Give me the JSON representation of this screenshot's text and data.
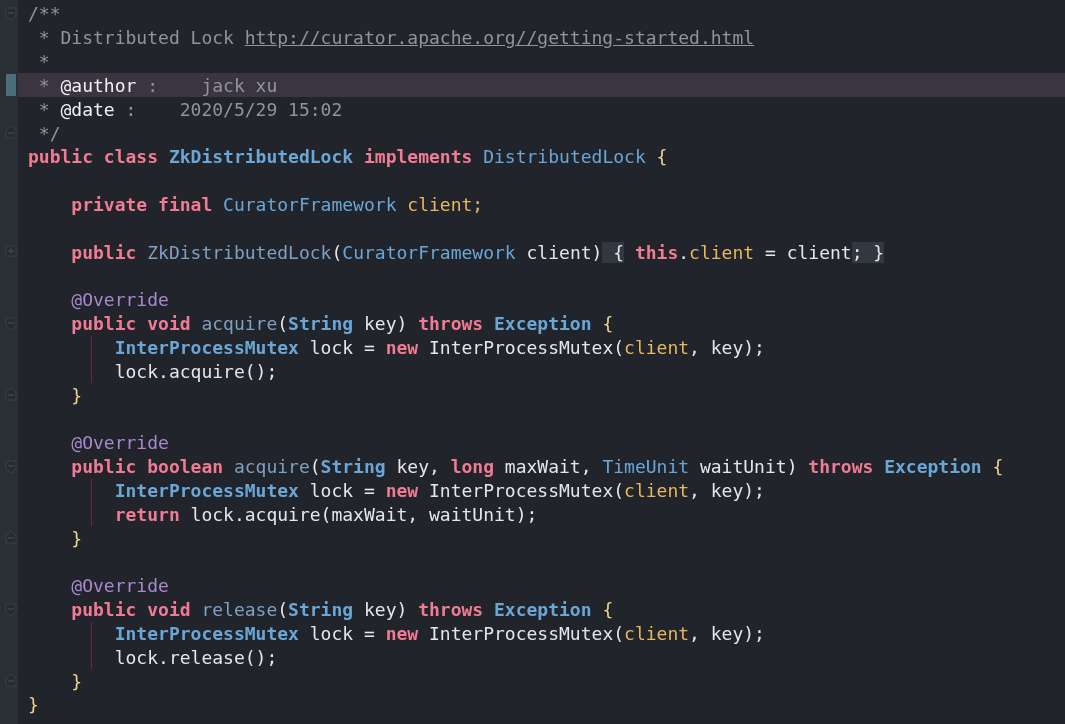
{
  "editor": {
    "blocks": [
      {
        "lines": [
          {
            "fold": {
              "kind": "start"
            },
            "tokens": [
              {
                "kind": "comment",
                "text": "/**"
              }
            ]
          },
          {
            "tokens": [
              {
                "kind": "comment",
                "text": " * Distributed Lock "
              },
              {
                "kind": "link",
                "text": "http://curator.apache.org//getting-started.html"
              }
            ]
          },
          {
            "tokens": [
              {
                "kind": "comment",
                "text": " *"
              }
            ]
          },
          {
            "highlighted": true,
            "tokens": [
              {
                "kind": "comment",
                "text": " * "
              },
              {
                "kind": "tag",
                "text": "@author"
              },
              {
                "kind": "comment",
                "text": " :    jack xu"
              }
            ]
          },
          {
            "tokens": [
              {
                "kind": "comment",
                "text": " * "
              },
              {
                "kind": "tag",
                "text": "@date"
              },
              {
                "kind": "comment",
                "text": " :    2020/5/29 15:02"
              }
            ]
          },
          {
            "fold": {
              "kind": "end"
            },
            "tokens": [
              {
                "kind": "comment",
                "text": " */"
              }
            ]
          },
          {
            "tokens": [
              {
                "kind": "keyword",
                "text": "public class "
              },
              {
                "kind": "type",
                "text": "ZkDistributedLock "
              },
              {
                "kind": "keyword",
                "text": "implements "
              },
              {
                "kind": "typeref",
                "text": "DistributedLock "
              },
              {
                "kind": "brace",
                "text": "{"
              }
            ]
          }
        ]
      },
      {
        "lines": [
          {
            "tokens": [
              {
                "kind": "keyword",
                "text": "    private final "
              },
              {
                "kind": "typeref",
                "text": "CuratorFramework "
              },
              {
                "kind": "field",
                "text": "client;"
              }
            ]
          }
        ]
      },
      {
        "lines": [
          {
            "fold": {
              "kind": "collapsed"
            },
            "tokens": [
              {
                "kind": "keyword",
                "text": "    public "
              },
              {
                "kind": "method",
                "text": "ZkDistributedLock"
              },
              {
                "kind": "plain",
                "text": "("
              },
              {
                "kind": "typeref",
                "text": "CuratorFramework "
              },
              {
                "kind": "plain",
                "text": "client)"
              },
              {
                "kind": "folded",
                "text": " {"
              },
              {
                "kind": "keyword",
                "text": " this"
              },
              {
                "kind": "plain",
                "text": "."
              },
              {
                "kind": "field",
                "text": "client"
              },
              {
                "kind": "plain",
                "text": " = client"
              },
              {
                "kind": "folded",
                "text": "; }"
              }
            ]
          }
        ]
      },
      {
        "lines": [
          {
            "tokens": [
              {
                "kind": "annotation",
                "text": "    @Override"
              }
            ]
          },
          {
            "fold": {
              "kind": "start"
            },
            "tokens": [
              {
                "kind": "keyword",
                "text": "    public void "
              },
              {
                "kind": "method",
                "text": "acquire"
              },
              {
                "kind": "plain",
                "text": "("
              },
              {
                "kind": "type",
                "text": "String "
              },
              {
                "kind": "plain",
                "text": "key) "
              },
              {
                "kind": "keyword",
                "text": "throws "
              },
              {
                "kind": "type",
                "text": "Exception "
              },
              {
                "kind": "brace",
                "text": "{"
              }
            ]
          },
          {
            "guide": true,
            "tokens": [
              {
                "kind": "type",
                "text": "        InterProcessMutex "
              },
              {
                "kind": "plain",
                "text": "lock = "
              },
              {
                "kind": "keyword",
                "text": "new "
              },
              {
                "kind": "plain",
                "text": "InterProcessMutex("
              },
              {
                "kind": "field",
                "text": "client"
              },
              {
                "kind": "plain",
                "text": ", key);"
              }
            ]
          },
          {
            "guide": true,
            "tokens": [
              {
                "kind": "plain",
                "text": "        lock.acquire();"
              }
            ]
          },
          {
            "fold": {
              "kind": "end"
            },
            "tokens": [
              {
                "kind": "brace",
                "text": "    }"
              }
            ]
          }
        ]
      },
      {
        "lines": [
          {
            "tokens": [
              {
                "kind": "annotation",
                "text": "    @Override"
              }
            ]
          },
          {
            "fold": {
              "kind": "start"
            },
            "tokens": [
              {
                "kind": "keyword",
                "text": "    public boolean "
              },
              {
                "kind": "method",
                "text": "acquire"
              },
              {
                "kind": "plain",
                "text": "("
              },
              {
                "kind": "type",
                "text": "String "
              },
              {
                "kind": "plain",
                "text": "key, "
              },
              {
                "kind": "keyword",
                "text": "long "
              },
              {
                "kind": "plain",
                "text": "maxWait, "
              },
              {
                "kind": "typeref",
                "text": "TimeUnit "
              },
              {
                "kind": "plain",
                "text": "waitUnit) "
              },
              {
                "kind": "keyword",
                "text": "throws "
              },
              {
                "kind": "type",
                "text": "Exception "
              },
              {
                "kind": "brace",
                "text": "{"
              }
            ]
          },
          {
            "guide": true,
            "tokens": [
              {
                "kind": "type",
                "text": "        InterProcessMutex "
              },
              {
                "kind": "plain",
                "text": "lock = "
              },
              {
                "kind": "keyword",
                "text": "new "
              },
              {
                "kind": "plain",
                "text": "InterProcessMutex("
              },
              {
                "kind": "field",
                "text": "client"
              },
              {
                "kind": "plain",
                "text": ", key);"
              }
            ]
          },
          {
            "guide": true,
            "tokens": [
              {
                "kind": "keyword",
                "text": "        return "
              },
              {
                "kind": "plain",
                "text": "lock.acquire(maxWait, waitUnit);"
              }
            ]
          },
          {
            "fold": {
              "kind": "end"
            },
            "tokens": [
              {
                "kind": "brace",
                "text": "    }"
              }
            ]
          }
        ]
      },
      {
        "lines": [
          {
            "tokens": [
              {
                "kind": "annotation",
                "text": "    @Override"
              }
            ]
          },
          {
            "fold": {
              "kind": "start"
            },
            "tokens": [
              {
                "kind": "keyword",
                "text": "    public void "
              },
              {
                "kind": "method",
                "text": "release"
              },
              {
                "kind": "plain",
                "text": "("
              },
              {
                "kind": "type",
                "text": "String "
              },
              {
                "kind": "plain",
                "text": "key) "
              },
              {
                "kind": "keyword",
                "text": "throws "
              },
              {
                "kind": "type",
                "text": "Exception "
              },
              {
                "kind": "brace",
                "text": "{"
              }
            ]
          },
          {
            "guide": true,
            "tokens": [
              {
                "kind": "type",
                "text": "        InterProcessMutex "
              },
              {
                "kind": "plain",
                "text": "lock = "
              },
              {
                "kind": "keyword",
                "text": "new "
              },
              {
                "kind": "plain",
                "text": "InterProcessMutex("
              },
              {
                "kind": "field",
                "text": "client"
              },
              {
                "kind": "plain",
                "text": ", key);"
              }
            ]
          },
          {
            "guide": true,
            "tokens": [
              {
                "kind": "plain",
                "text": "        lock.release();"
              }
            ]
          },
          {
            "fold": {
              "kind": "end"
            },
            "tokens": [
              {
                "kind": "brace",
                "text": "    }"
              }
            ]
          },
          {
            "tokens": [
              {
                "kind": "brace",
                "text": "}"
              }
            ]
          }
        ]
      }
    ]
  }
}
